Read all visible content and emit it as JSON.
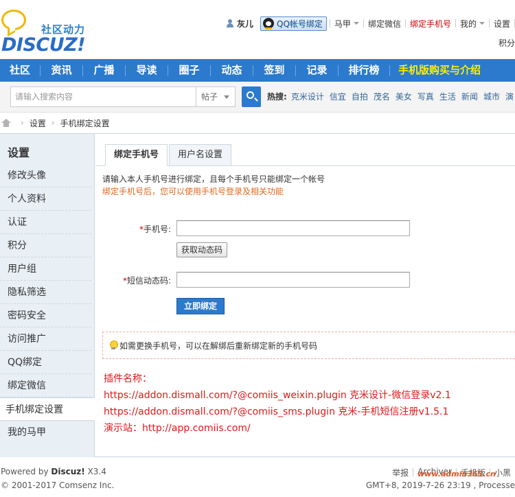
{
  "header": {
    "logo_slogan": "社区动力",
    "logo_brand": "DISCUZ!",
    "topbar": {
      "username": "灰儿",
      "qq_bind": "QQ帐号绑定",
      "majia": "马甲",
      "bind_wechat": "绑定微信",
      "bind_phone": "绑定手机号",
      "mine": "我的",
      "settings": "设置"
    },
    "topbar_second": "积分"
  },
  "nav": {
    "items": [
      "社区",
      "资讯",
      "广播",
      "导读",
      "圈子",
      "动态",
      "签到",
      "记录",
      "排行榜"
    ],
    "highlight": "手机版购买与介绍"
  },
  "search": {
    "placeholder": "请输入搜索内容",
    "scope": "帖子",
    "hot_label": "热搜:",
    "hot_words": [
      "克米设计",
      "信宜",
      "自拍",
      "茂名",
      "美女",
      "写真",
      "生活",
      "新闻",
      "城市",
      "演"
    ]
  },
  "breadcrumb": {
    "items": [
      "设置",
      "手机绑定设置"
    ]
  },
  "sidebar": {
    "title": "设置",
    "items": [
      "修改头像",
      "个人资料",
      "认证",
      "积分",
      "用户组",
      "隐私筛选",
      "密码安全",
      "访问推广",
      "QQ绑定",
      "绑定微信",
      "手机绑定设置",
      "我的马甲"
    ],
    "active_index": 10
  },
  "content": {
    "tabs": [
      "绑定手机号",
      "用户名设置"
    ],
    "tip1": "请输入本人手机号进行绑定，且每个手机号只能绑定一个帐号",
    "tip2": "绑定手机号后，您可以使用手机号登录及相关功能",
    "phone_label": "手机号:",
    "code_button": "获取动态码",
    "sms_label": "短信动态码:",
    "submit_button": "立即绑定",
    "notice": "如需更换手机号，可以在解绑后重新绑定新的手机号码",
    "plugin": {
      "title": "插件名称：",
      "line1": "https://addon.dismall.com/?@comiis_weixin.plugin      克米设计-微信登录v2.1",
      "line2": "https://addon.dismall.com/?@comiis_sms.plugin      克米-手机短信注册v1.5.1",
      "line3": "演示站：http://app.comiis.com/"
    }
  },
  "footer": {
    "powered_prefix": "Powered by ",
    "powered_brand": "Discuz!",
    "powered_version": " X3.4",
    "copyright": "© 2001-2017 Comsenz Inc.",
    "links": [
      "举报",
      "Archiver",
      "手机版",
      "小黑"
    ],
    "gmt": "GMT+8, 2019-7-26 23:19 , Processe",
    "watermark": "www.admin365.cn"
  },
  "colors": {
    "nav_bg": "#2b7acd",
    "nav_highlight": "#ffee00",
    "sidebar_bg": "#e8eff5",
    "plugin_text": "#e01818",
    "tip_orange": "#e0681f"
  }
}
